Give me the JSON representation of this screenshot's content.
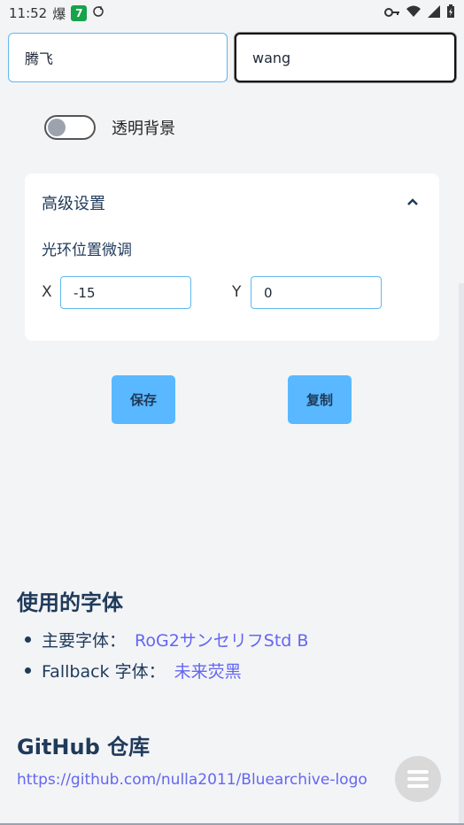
{
  "status": {
    "time": "11:52",
    "indicator": "爆",
    "badge": "7",
    "icons": [
      "key-icon",
      "wifi-icon",
      "signal-icon",
      "battery-icon"
    ]
  },
  "form": {
    "name_cn": "腾飞",
    "name_en": "wang",
    "transparent_toggle_label": "透明背景",
    "transparent_on": false
  },
  "advanced": {
    "title": "高级设置",
    "subtitle": "光环位置微调",
    "x_label": "X",
    "x_value": "-15",
    "y_label": "Y",
    "y_value": "0"
  },
  "actions": {
    "save_label": "保存",
    "copy_label": "复制"
  },
  "fonts_section": {
    "title": "使用的字体",
    "items": [
      {
        "prefix": "主要字体：",
        "link": "RoG2サンセリフStd B"
      },
      {
        "prefix": "Fallback 字体：",
        "link": "未来荧黑"
      }
    ]
  },
  "github_section": {
    "title": "GitHub 仓库",
    "url": "https://github.com/nulla2011/Bluearchive-logo"
  },
  "colors": {
    "accent": "#59b8ff",
    "link": "#6366f1",
    "heading": "#1f3a5a"
  }
}
